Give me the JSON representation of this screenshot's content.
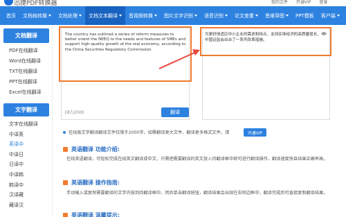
{
  "brand": {
    "name": "迅捷PDF转换器"
  },
  "toplinks": [
    "我的文件",
    "开通VIP",
    "登录"
  ],
  "nav": [
    {
      "label": "首页",
      "active": false,
      "dropdown": false
    },
    {
      "label": "文档格转换",
      "active": false,
      "dropdown": true
    },
    {
      "label": "文档处理",
      "active": false,
      "dropdown": true
    },
    {
      "label": "文档文本翻译",
      "active": true,
      "dropdown": true
    },
    {
      "label": "音视频转换",
      "active": false,
      "dropdown": true
    },
    {
      "label": "图片文字识别",
      "active": false,
      "dropdown": true
    },
    {
      "label": "语音识别",
      "active": false,
      "dropdown": true
    },
    {
      "label": "论文查重",
      "active": false,
      "dropdown": true
    },
    {
      "label": "思维导图",
      "active": false,
      "dropdown": true
    },
    {
      "label": "PPT模板",
      "active": false,
      "dropdown": false
    },
    {
      "label": "客户端",
      "active": false,
      "dropdown": true
    }
  ],
  "sidebar": {
    "section1": "文档翻译",
    "items1": [
      "PDF在线翻译",
      "Word在线翻译",
      "TXT在线翻译",
      "PPT在线翻译",
      "Excel在线翻译"
    ],
    "section2": "文字翻译",
    "items2": [
      "文字在线翻译",
      "中译英",
      "英译中",
      "中译日",
      "日译中",
      "中译韩",
      "韩译中",
      "汉译藏",
      "藏译汉"
    ],
    "active_item": "英译中"
  },
  "translator": {
    "source_text": "The country has outlined a series of reform measures to better orient the NEEQ to the needs and features of SMEs and support high-quality growth of the real economy, according to the China Securities Regulatory Commission.",
    "char_count": "187/2000",
    "translate_label": "翻译",
    "result_text": "为更好地适应中小企业的需求和特点、支持实体经济的高质量增长，中国证监会出台了一系列改革措施。"
  },
  "notice": {
    "text": "在线版文字翻译翻译文件仅限于2000字。如需翻译更大文件、翻译更多格式文件，请",
    "vip_label": "开通VIP"
  },
  "sections": [
    {
      "title": "英语翻译 功能介绍:",
      "body": "在线英语翻译，可轻松完成在线英文翻译成中文，只需把需要翻译的英文放入待翻译框中即可进行翻译操作，翻译速度快且结果正确率高。"
    },
    {
      "title": "英语翻译 操作指南:",
      "body": "手动输入或复制需要翻译的文字内容到待翻译框中，然后单击翻译按钮，翻译结果会出现在右侧边框中，翻译完成后可直接复制翻译结果。"
    },
    {
      "title": "英语翻译 温馨提示:",
      "body": ""
    }
  ],
  "colors": {
    "primary": "#2d82e0",
    "nav_active": "#1763bf",
    "highlight": "#f07a2e"
  }
}
